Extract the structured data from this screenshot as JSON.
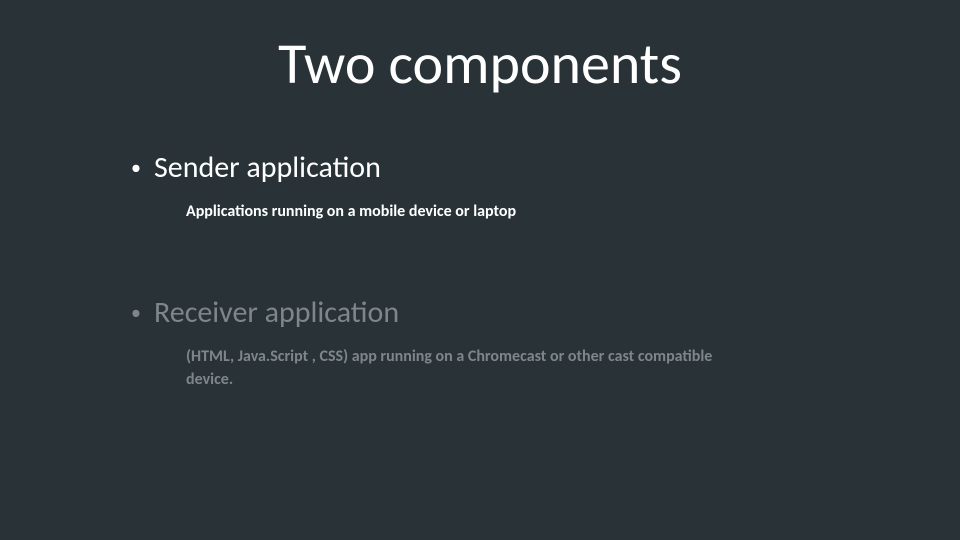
{
  "title": "Two components",
  "items": [
    {
      "label": "Sender application",
      "description": "Applications running on a mobile device or laptop",
      "dimmed": false
    },
    {
      "label": "Receiver application",
      "description": "(HTML, Java.Script , CSS) app running on a Chromecast or other cast compatible device.",
      "dimmed": true
    }
  ]
}
